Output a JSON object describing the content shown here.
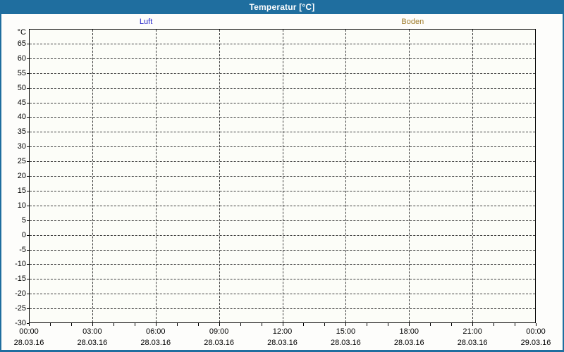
{
  "window": {
    "title": "Temperatur [°C]"
  },
  "colors": {
    "titlebar_bg": "#1F6E9F",
    "window_border": "#1F6E9F",
    "content_bg": "#FDFDFB",
    "plot_bg": "#FCFDF8",
    "grid": "#3C3C3C",
    "axis": "#000000",
    "title_text": "#FFFFFF",
    "luft": "#2222C8",
    "boden": "#9E7B2A"
  },
  "chart_data": {
    "type": "line",
    "title": "Temperatur [°C]",
    "ylabel": "°C",
    "ylim": [
      -30,
      70
    ],
    "ytick_step": 5,
    "yticks": [
      65,
      60,
      55,
      50,
      45,
      40,
      35,
      30,
      25,
      20,
      15,
      10,
      5,
      0,
      -5,
      -10,
      -15,
      -20,
      -25,
      -30
    ],
    "xticks": [
      {
        "time": "00:00",
        "date": "28.03.16"
      },
      {
        "time": "03:00",
        "date": "28.03.16"
      },
      {
        "time": "06:00",
        "date": "28.03.16"
      },
      {
        "time": "09:00",
        "date": "28.03.16"
      },
      {
        "time": "12:00",
        "date": "28.03.16"
      },
      {
        "time": "15:00",
        "date": "28.03.16"
      },
      {
        "time": "18:00",
        "date": "28.03.16"
      },
      {
        "time": "21:00",
        "date": "28.03.16"
      },
      {
        "time": "00:00",
        "date": "29.03.16"
      }
    ],
    "minor_xticks_per_hour": true,
    "hours_total": 24,
    "grid": true,
    "legend_position": "top",
    "legend": [
      {
        "label": "Luft",
        "color": "#2222C8"
      },
      {
        "label": "Boden",
        "color": "#9E7B2A"
      }
    ],
    "series": [
      {
        "name": "Luft",
        "color": "#2222C8",
        "points": []
      },
      {
        "name": "Boden",
        "color": "#9E7B2A",
        "points": []
      }
    ]
  }
}
